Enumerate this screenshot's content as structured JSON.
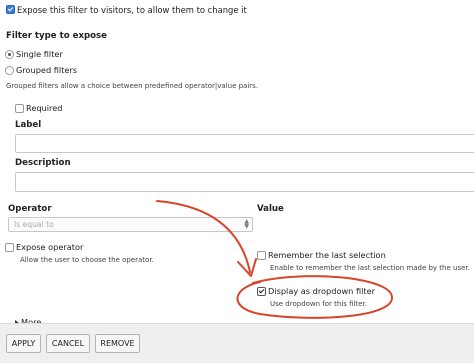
{
  "expose": {
    "checkbox_label": "Expose this filter to visitors, to allow them to change it"
  },
  "filter_type": {
    "heading": "Filter type to expose",
    "options": [
      "Single filter",
      "Grouped filters"
    ],
    "selected": "Single filter",
    "description": "Grouped filters allow a choice between predefined operator|value pairs."
  },
  "required_label": "Required",
  "label_field": {
    "label": "Label",
    "value": ""
  },
  "description_field": {
    "label": "Description",
    "value": ""
  },
  "operator": {
    "label": "Operator",
    "selected": "Is equal to"
  },
  "value": {
    "label": "Value"
  },
  "expose_operator": {
    "label": "Expose operator",
    "description": "Allow the user to choose the operator."
  },
  "remember_selection": {
    "label": "Remember the last selection",
    "description": "Enable to remember the last selection made by the user."
  },
  "dropdown": {
    "label": "Display as dropdown filter",
    "description": "Use dropdown for this filter.",
    "checked": true
  },
  "more_label": "More",
  "buttons": {
    "apply": "APPLY",
    "cancel": "CANCEL",
    "remove": "REMOVE"
  },
  "annotation": {
    "color": "#d9452b"
  }
}
